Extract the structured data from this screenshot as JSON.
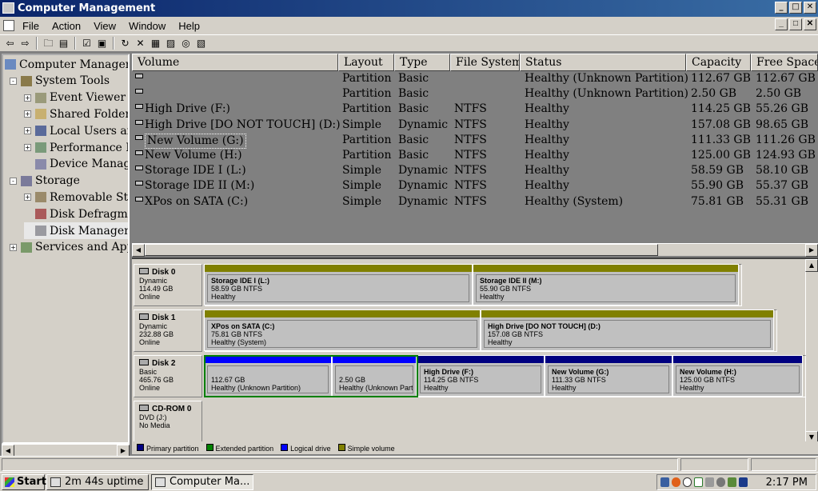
{
  "window": {
    "title": "Computer Management"
  },
  "menu": [
    "File",
    "Action",
    "View",
    "Window",
    "Help"
  ],
  "toolbar_icons": [
    "back-arrow-icon",
    "forward-arrow-icon",
    "up-folder-icon",
    "show-hide-tree-icon",
    "properties-icon",
    "help-icon",
    "refresh-icon",
    "delete-icon",
    "disk-properties-icon",
    "open-icon",
    "search-icon",
    "export-icon"
  ],
  "tree": [
    {
      "label": "Computer Management",
      "expander": "",
      "level": 0,
      "icon": "computer-icon"
    },
    {
      "label": "System Tools",
      "expander": "-",
      "level": 1,
      "icon": "tools-icon"
    },
    {
      "label": "Event Viewer",
      "expander": "+",
      "level": 2,
      "icon": "event-viewer-icon"
    },
    {
      "label": "Shared Folders",
      "expander": "+",
      "level": 2,
      "icon": "shared-folder-icon"
    },
    {
      "label": "Local Users and Groups",
      "expander": "+",
      "level": 2,
      "icon": "users-icon"
    },
    {
      "label": "Performance Logs and Alerts",
      "expander": "+",
      "level": 2,
      "icon": "performance-icon"
    },
    {
      "label": "Device Manager",
      "expander": "",
      "level": 2,
      "icon": "device-manager-icon"
    },
    {
      "label": "Storage",
      "expander": "-",
      "level": 1,
      "icon": "storage-icon"
    },
    {
      "label": "Removable Storage",
      "expander": "+",
      "level": 2,
      "icon": "removable-storage-icon"
    },
    {
      "label": "Disk Defragmenter",
      "expander": "",
      "level": 2,
      "icon": "defrag-icon"
    },
    {
      "label": "Disk Management",
      "expander": "",
      "level": 2,
      "icon": "disk-management-icon",
      "selected": true
    },
    {
      "label": "Services and Applications",
      "expander": "+",
      "level": 1,
      "icon": "services-icon"
    }
  ],
  "columns": [
    "Volume",
    "Layout",
    "Type",
    "File System",
    "Status",
    "Capacity",
    "Free Space"
  ],
  "volumes": [
    {
      "volume": "",
      "layout": "Partition",
      "type": "Basic",
      "fs": "",
      "status": "Healthy (Unknown Partition)",
      "capacity": "112.67 GB",
      "free": "112.67 GB"
    },
    {
      "volume": "",
      "layout": "Partition",
      "type": "Basic",
      "fs": "",
      "status": "Healthy (Unknown Partition)",
      "capacity": "2.50 GB",
      "free": "2.50 GB"
    },
    {
      "volume": "High Drive (F:)",
      "layout": "Partition",
      "type": "Basic",
      "fs": "NTFS",
      "status": "Healthy",
      "capacity": "114.25 GB",
      "free": "55.26 GB"
    },
    {
      "volume": "High Drive [DO NOT TOUCH] (D:)",
      "layout": "Simple",
      "type": "Dynamic",
      "fs": "NTFS",
      "status": "Healthy",
      "capacity": "157.08 GB",
      "free": "98.65 GB"
    },
    {
      "volume": "New Volume (G:)",
      "layout": "Partition",
      "type": "Basic",
      "fs": "NTFS",
      "status": "Healthy",
      "capacity": "111.33 GB",
      "free": "111.26 GB",
      "focus": true
    },
    {
      "volume": "New Volume (H:)",
      "layout": "Partition",
      "type": "Basic",
      "fs": "NTFS",
      "status": "Healthy",
      "capacity": "125.00 GB",
      "free": "124.93 GB"
    },
    {
      "volume": "Storage IDE I (L:)",
      "layout": "Simple",
      "type": "Dynamic",
      "fs": "NTFS",
      "status": "Healthy",
      "capacity": "58.59 GB",
      "free": "58.10 GB"
    },
    {
      "volume": "Storage IDE II (M:)",
      "layout": "Simple",
      "type": "Dynamic",
      "fs": "NTFS",
      "status": "Healthy",
      "capacity": "55.90 GB",
      "free": "55.37 GB"
    },
    {
      "volume": "XPos on SATA (C:)",
      "layout": "Simple",
      "type": "Dynamic",
      "fs": "NTFS",
      "status": "Healthy (System)",
      "capacity": "75.81 GB",
      "free": "55.31 GB"
    }
  ],
  "disks": [
    {
      "name": "Disk 0",
      "kind": "Dynamic",
      "size": "114.49 GB",
      "state": "Online",
      "partitions": [
        {
          "title": "Storage IDE I  (L:)",
          "line2": "58.59 GB NTFS",
          "line3": "Healthy",
          "color": "#808000"
        },
        {
          "title": "Storage IDE II  (M:)",
          "line2": "55.90 GB NTFS",
          "line3": "Healthy",
          "color": "#808000"
        }
      ]
    },
    {
      "name": "Disk 1",
      "kind": "Dynamic",
      "size": "232.88 GB",
      "state": "Online",
      "partitions": [
        {
          "title": "XPos on SATA  (C:)",
          "line2": "75.81 GB NTFS",
          "line3": "Healthy (System)",
          "color": "#808000"
        },
        {
          "title": "High Drive [DO NOT TOUCH]  (D:)",
          "line2": "157.08 GB NTFS",
          "line3": "Healthy",
          "color": "#808000"
        }
      ]
    },
    {
      "name": "Disk 2",
      "kind": "Basic",
      "size": "465.76 GB",
      "state": "Online",
      "partitions": [
        {
          "title": "",
          "line2": "112.67 GB",
          "line3": "Healthy (Unknown Partition)",
          "color": "#0000ff"
        },
        {
          "title": "",
          "line2": "2.50 GB",
          "line3": "Healthy (Unknown Partit",
          "color": "#0000ff"
        },
        {
          "title": "High Drive  (F:)",
          "line2": "114.25 GB NTFS",
          "line3": "Healthy",
          "color": "#000080"
        },
        {
          "title": "New Volume  (G:)",
          "line2": "111.33 GB NTFS",
          "line3": "Healthy",
          "color": "#000080"
        },
        {
          "title": "New Volume  (H:)",
          "line2": "125.00 GB NTFS",
          "line3": "Healthy",
          "color": "#000080"
        }
      ]
    },
    {
      "name": "CD-ROM 0",
      "kind": "DVD (J:)",
      "size": "",
      "state": "No Media",
      "partitions": []
    }
  ],
  "legend": [
    {
      "label": "Primary partition",
      "color": "#000080"
    },
    {
      "label": "Extended partition",
      "color": "#008000"
    },
    {
      "label": "Logical drive",
      "color": "#0000ff"
    },
    {
      "label": "Simple volume",
      "color": "#808000"
    }
  ],
  "taskbar": {
    "start": "Start",
    "tasks": [
      "2m 44s uptime",
      "Computer Ma..."
    ],
    "clock": "2:17 PM",
    "tray_icons": [
      "network-icon",
      "firefox-icon",
      "clock-icon",
      "vg-icon",
      "tool-icon",
      "shield-icon",
      "gear-icon",
      "monitor-icon"
    ]
  }
}
